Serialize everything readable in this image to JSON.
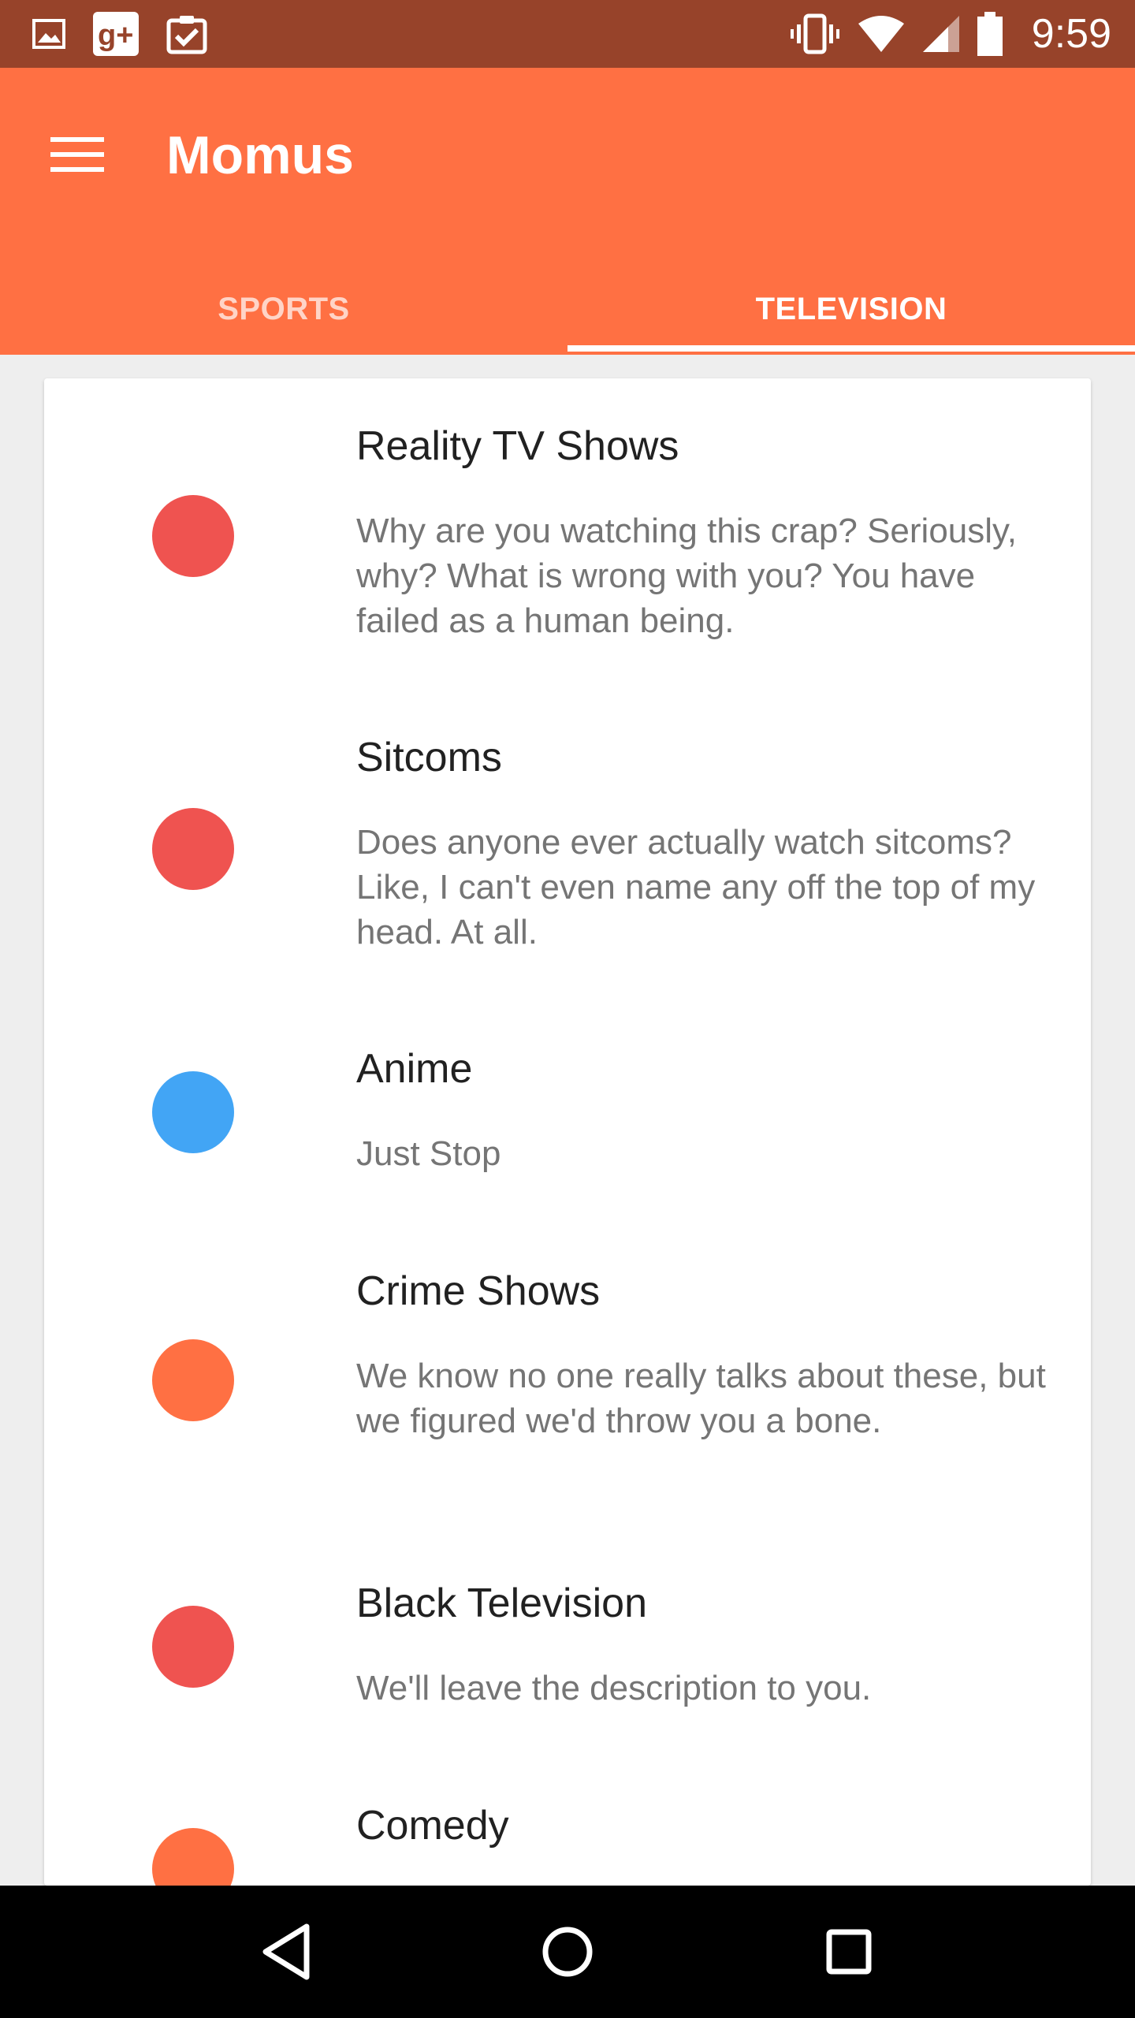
{
  "status_bar": {
    "time": "9:59",
    "left_icons": [
      "image-icon",
      "google-plus-icon",
      "clipboard-check-icon"
    ],
    "right_icons": [
      "vibrate-icon",
      "wifi-icon",
      "signal-icon",
      "battery-icon"
    ]
  },
  "app_bar": {
    "title": "Momus",
    "menu_icon": "hamburger-menu-icon",
    "background": "#ff7043"
  },
  "tabs": [
    {
      "label": "SPORTS",
      "selected": false
    },
    {
      "label": "TELEVISION",
      "selected": true
    }
  ],
  "list": {
    "items": [
      {
        "title": "Reality TV Shows",
        "description": "Why are you watching this crap? Seriously, why? What is wrong with you? You have failed as a human being.",
        "color": "#ef5350"
      },
      {
        "title": "Sitcoms",
        "description": "Does anyone ever actually watch sitcoms? Like, I can't even name any off the top of my head. At all.",
        "color": "#ef5350"
      },
      {
        "title": "Anime",
        "description": "Just Stop",
        "color": "#42a5f5"
      },
      {
        "title": "Crime Shows",
        "description": "We know no one really talks about these, but we figured we'd throw you a bone.",
        "color": "#ff7043"
      },
      {
        "title": "Black Television",
        "description": "We'll leave the description to you.",
        "color": "#ef5350"
      },
      {
        "title": "Comedy",
        "description": "",
        "color": "#ff7043"
      }
    ]
  },
  "nav_bar": {
    "buttons": [
      "back-icon",
      "home-icon",
      "recents-icon"
    ]
  }
}
